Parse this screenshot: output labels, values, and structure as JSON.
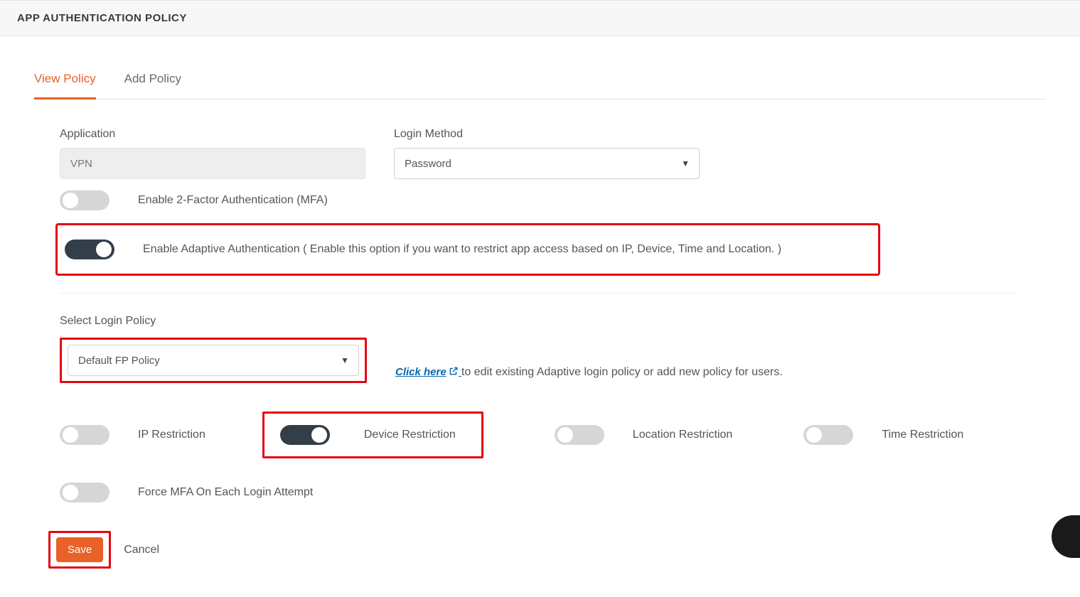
{
  "header": {
    "title": "APP AUTHENTICATION POLICY"
  },
  "tabs": {
    "viewPolicy": "View Policy",
    "addPolicy": "Add Policy"
  },
  "labels": {
    "application": "Application",
    "loginMethod": "Login Method",
    "enableMfa": "Enable 2-Factor Authentication (MFA)",
    "enableAdaptive": "Enable Adaptive Authentication ( Enable this option if you want to restrict app access based on IP, Device, Time and Location. )",
    "selectLoginPolicy": "Select Login Policy",
    "clickHere": "Click here",
    "policyInfo": " to edit existing Adaptive login policy or add new policy for users.",
    "ipRestriction": "IP Restriction",
    "deviceRestriction": "Device Restriction",
    "locationRestriction": "Location Restriction",
    "timeRestriction": "Time Restriction",
    "forceMfa": "Force MFA On Each Login Attempt",
    "save": "Save",
    "cancel": "Cancel"
  },
  "values": {
    "application": "VPN",
    "loginMethod": "Password",
    "loginPolicy": "Default FP Policy"
  }
}
